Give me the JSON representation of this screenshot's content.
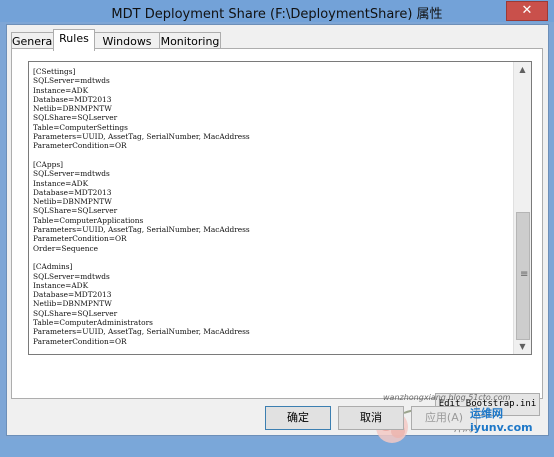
{
  "window": {
    "title": "MDT Deployment Share (F:\\DeploymentShare) 属性",
    "close_label": "✕"
  },
  "tabs": [
    {
      "label": "General"
    },
    {
      "label": "Rules"
    },
    {
      "label": "Windows PE"
    },
    {
      "label": "Monitoring"
    }
  ],
  "active_tab": "Rules",
  "rules_text": "[CSettings]\nSQLServer=mdtwds\nInstance=ADK\nDatabase=MDT2013\nNetlib=DBNMPNTW\nSQLShare=SQLserver\nTable=ComputerSettings\nParameters=UUID, AssetTag, SerialNumber, MacAddress\nParameterCondition=OR\n\n[CApps]\nSQLServer=mdtwds\nInstance=ADK\nDatabase=MDT2013\nNetlib=DBNMPNTW\nSQLShare=SQLserver\nTable=ComputerApplications\nParameters=UUID, AssetTag, SerialNumber, MacAddress\nParameterCondition=OR\nOrder=Sequence\n\n[CAdmins]\nSQLServer=mdtwds\nInstance=ADK\nDatabase=MDT2013\nNetlib=DBNMPNTW\nSQLShare=SQLserver\nTable=ComputerAdministrators\nParameters=UUID, AssetTag, SerialNumber, MacAddress\nParameterCondition=OR",
  "edit_bootstrap_label": "Edit Bootstrap.ini",
  "buttons": {
    "ok": "确定",
    "cancel": "取消",
    "apply": "应用(A)"
  },
  "scrollbar": {
    "up_icon": "arrow-up-icon",
    "down_icon": "arrow-down-icon",
    "grip": "≡"
  },
  "watermark": {
    "site_text": "wanzhongxiang.blog.51cto.com",
    "logo_text": "运维网 iyunv.com"
  }
}
